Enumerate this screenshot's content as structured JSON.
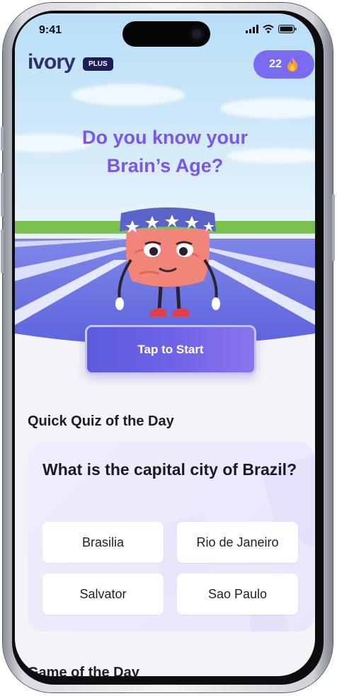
{
  "status_bar": {
    "time": "9:41"
  },
  "header": {
    "logo_text": "ivory",
    "badge": "PLUS",
    "streak_count": "22",
    "streak_icon": "fire-icon"
  },
  "hero": {
    "title_line1": "Do you know your",
    "title_line2": "Brain’s Age?",
    "cta": "Tap to Start"
  },
  "quick_quiz": {
    "title": "Quick Quiz of the Day",
    "question": "What is the capital city of Brazil?",
    "answers": [
      "Brasilia",
      "Rio de Janeiro",
      "Salvator",
      "Sao Paulo"
    ]
  },
  "game_of_day": {
    "title": "Game of the Day"
  },
  "colors": {
    "accent": "#7b56e8",
    "button": "#6b60e6",
    "brand_dark": "#2f2e6e"
  }
}
